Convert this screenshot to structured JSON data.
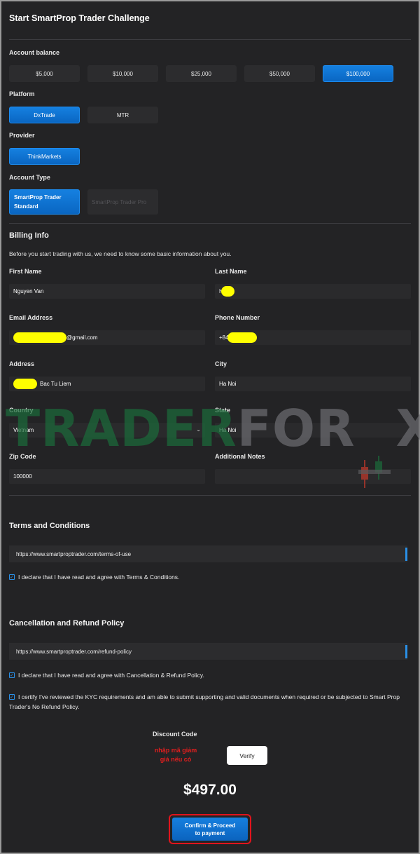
{
  "header": {
    "title": "Start SmartProp Trader Challenge"
  },
  "account_balance": {
    "label": "Account balance",
    "options": [
      "$5,000",
      "$10,000",
      "$25,000",
      "$50,000",
      "$100,000"
    ],
    "selected": "$100,000"
  },
  "platform": {
    "label": "Platform",
    "options": [
      "DxTrade",
      "MTR"
    ],
    "selected": "DxTrade"
  },
  "provider": {
    "label": "Provider",
    "options": [
      "ThinkMarkets"
    ],
    "selected": "ThinkMarkets"
  },
  "account_type": {
    "label": "Account Type",
    "options": [
      "SmartProp Trader Standard",
      "SmartProp Trader Pro"
    ],
    "selected": "SmartProp Trader Standard"
  },
  "billing": {
    "title": "Billing Info",
    "description": "Before you start trading with us, we need to know some basic information about you.",
    "first_name": {
      "label": "First Name",
      "value": "Nguyen Van"
    },
    "last_name": {
      "label": "Last Name",
      "value": "H"
    },
    "email": {
      "label": "Email Address",
      "value": "@gmail.com"
    },
    "phone": {
      "label": "Phone Number",
      "value": "+84"
    },
    "address": {
      "label": "Address",
      "value": "Bac Tu Liem"
    },
    "city": {
      "label": "City",
      "value": "Ha Noi"
    },
    "country": {
      "label": "Country",
      "value": "Vietnam"
    },
    "state": {
      "label": "State",
      "value": "Ha Noi"
    },
    "zip": {
      "label": "Zip Code",
      "value": "100000"
    },
    "notes": {
      "label": "Additional Notes",
      "value": ""
    }
  },
  "terms": {
    "title": "Terms and Conditions",
    "url": "https://www.smartproptrader.com/terms-of-use",
    "agree": "I declare that I have read and agree with Terms & Conditions."
  },
  "refund": {
    "title": "Cancellation and Refund Policy",
    "url": "https://www.smartproptrader.com/refund-policy",
    "agree": "I declare that I have read and agree with Cancellation & Refund Policy.",
    "kyc": "I certify I've reviewed the KYC requirements and am able to submit supporting and valid documents when required or be subjected to Smart Prop Trader's No Refund Policy."
  },
  "discount": {
    "label": "Discount Code",
    "note": "nhập mã giảm giá nếu có",
    "verify_label": "Verify"
  },
  "total": "$497.00",
  "confirm_label": "Confirm & Proceed to payment",
  "watermark": {
    "left": "TRADER",
    "right": "FOR",
    "last": "X"
  },
  "colors": {
    "accent": "#0a66c2",
    "highlight": "#ffff00",
    "annotation": "#e0141d"
  }
}
